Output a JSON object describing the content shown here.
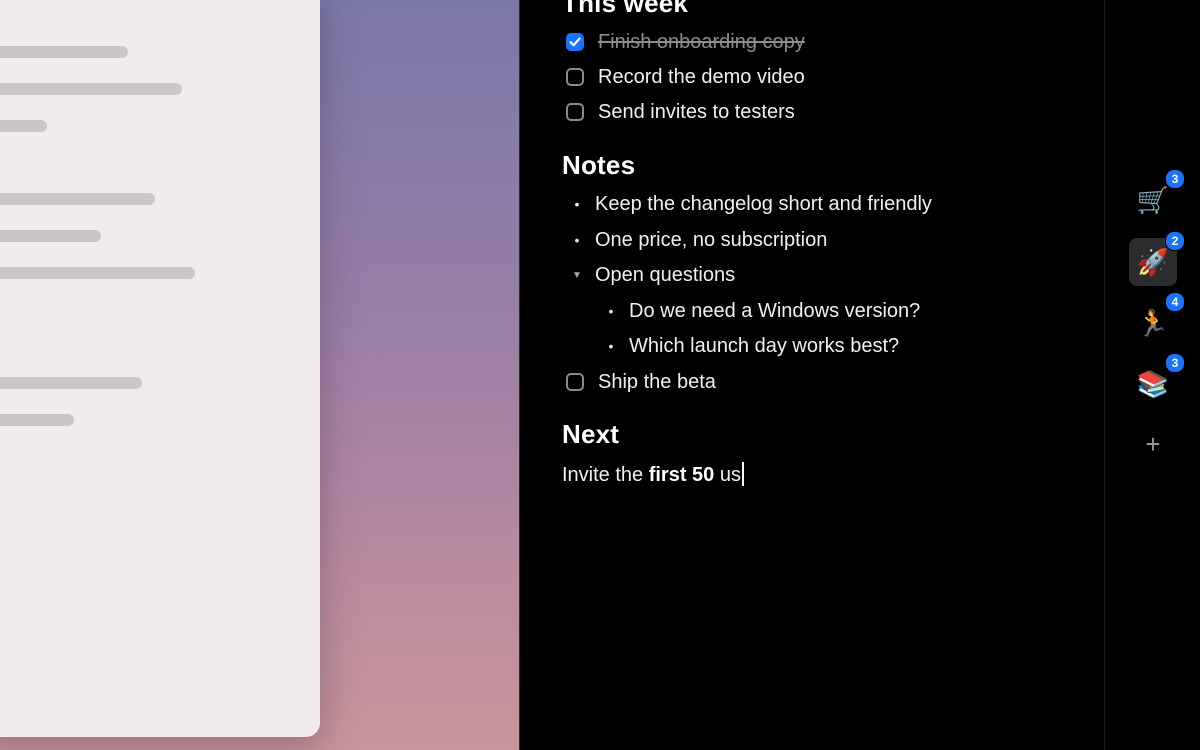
{
  "sections": {
    "this_week": {
      "heading": "This week",
      "tasks": [
        {
          "label": "Finish onboarding copy",
          "done": true
        },
        {
          "label": "Record the demo video",
          "done": false
        },
        {
          "label": "Send invites to testers",
          "done": false
        }
      ]
    },
    "notes": {
      "heading": "Notes",
      "bullets": [
        "Keep the changelog short and friendly",
        "One price, no subscription"
      ],
      "group": {
        "label": "Open questions",
        "children": [
          "Do we need a Windows version?",
          "Which launch day works best?"
        ]
      },
      "task": {
        "label": "Ship the beta",
        "done": false
      }
    },
    "next": {
      "heading": "Next",
      "text_before": "Invite the ",
      "text_bold": "first 50",
      "text_after": " us"
    }
  },
  "rail": {
    "items": [
      {
        "icon": "🛒",
        "icon_name": "shopping-cart-icon",
        "badge": "3",
        "active": false
      },
      {
        "icon": "🚀",
        "icon_name": "rocket-icon",
        "badge": "2",
        "active": true
      },
      {
        "icon": "🏃",
        "icon_name": "runner-icon",
        "badge": "4",
        "active": false
      },
      {
        "icon": "📚",
        "icon_name": "books-icon",
        "badge": "3",
        "active": false
      }
    ],
    "add_symbol": "+"
  },
  "colors": {
    "accent": "#1a73ff",
    "panel_bg": "#000000"
  }
}
